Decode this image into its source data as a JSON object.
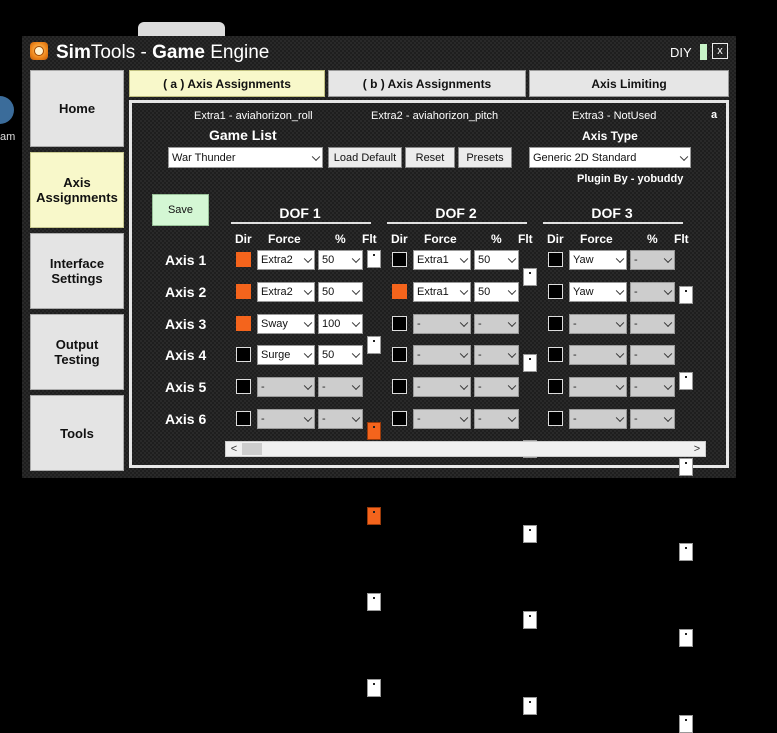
{
  "desktop": {
    "label": "am"
  },
  "window": {
    "title_sim": "Sim",
    "title_tools": "Tools - ",
    "title_game": "Game",
    "title_engine": " Engine",
    "diy_label": "DIY",
    "close_label": "x"
  },
  "sidebar": {
    "items": [
      {
        "label": "Home"
      },
      {
        "label": "Axis Assignments"
      },
      {
        "label": "Interface Settings"
      },
      {
        "label": "Output Testing"
      },
      {
        "label": "Tools"
      }
    ]
  },
  "tabs": [
    {
      "label": "( a ) Axis Assignments"
    },
    {
      "label": "( b ) Axis Assignments"
    },
    {
      "label": "Axis Limiting"
    }
  ],
  "extras": {
    "extra1": "Extra1 - aviahorizon_roll",
    "extra2": "Extra2 - aviahorizon_pitch",
    "extra3": "Extra3 - NotUsed",
    "corner": "a"
  },
  "game_list": {
    "label": "Game List",
    "selected": "War Thunder",
    "load_default": "Load Default",
    "reset": "Reset",
    "presets": "Presets"
  },
  "axis_type": {
    "label": "Axis Type",
    "selected": "Generic 2D Standard",
    "plugin_by": "Plugin By - yobuddy"
  },
  "save_label": "Save",
  "columns": {
    "dir": "Dir",
    "force": "Force",
    "pct": "%",
    "flt": "Flt"
  },
  "dofs": [
    {
      "title": "DOF 1"
    },
    {
      "title": "DOF 2"
    },
    {
      "title": "DOF 3"
    }
  ],
  "axes": [
    {
      "label": "Axis 1"
    },
    {
      "label": "Axis 2"
    },
    {
      "label": "Axis 3"
    },
    {
      "label": "Axis 4"
    },
    {
      "label": "Axis 5"
    },
    {
      "label": "Axis 6"
    }
  ],
  "grid": [
    [
      {
        "dir": true,
        "force": "Extra2",
        "pct": "50",
        "flt": false
      },
      {
        "dir": false,
        "force": "Extra1",
        "pct": "50",
        "flt": false
      },
      {
        "dir": false,
        "force": "Yaw",
        "pct": "-",
        "flt": false
      }
    ],
    [
      {
        "dir": true,
        "force": "Extra2",
        "pct": "50",
        "flt": false
      },
      {
        "dir": true,
        "force": "Extra1",
        "pct": "50",
        "flt": false
      },
      {
        "dir": false,
        "force": "Yaw",
        "pct": "-",
        "flt": false
      }
    ],
    [
      {
        "dir": true,
        "force": "Sway",
        "pct": "100",
        "flt": true
      },
      {
        "dir": false,
        "force": "-",
        "pct": "-",
        "flt": false
      },
      {
        "dir": false,
        "force": "-",
        "pct": "-",
        "flt": false
      }
    ],
    [
      {
        "dir": false,
        "force": "Surge",
        "pct": "50",
        "flt": true
      },
      {
        "dir": false,
        "force": "-",
        "pct": "-",
        "flt": false
      },
      {
        "dir": false,
        "force": "-",
        "pct": "-",
        "flt": false
      }
    ],
    [
      {
        "dir": false,
        "force": "-",
        "pct": "-",
        "flt": false
      },
      {
        "dir": false,
        "force": "-",
        "pct": "-",
        "flt": false
      },
      {
        "dir": false,
        "force": "-",
        "pct": "-",
        "flt": false
      }
    ],
    [
      {
        "dir": false,
        "force": "-",
        "pct": "-",
        "flt": false
      },
      {
        "dir": false,
        "force": "-",
        "pct": "-",
        "flt": false
      },
      {
        "dir": false,
        "force": "-",
        "pct": "-",
        "flt": false
      }
    ]
  ],
  "scrollbar": {
    "left": "<",
    "right": ">"
  },
  "colors": {
    "accent_orange": "#f4641c",
    "active_yellow": "#f8f8ca",
    "save_green": "#d4f7d4"
  }
}
